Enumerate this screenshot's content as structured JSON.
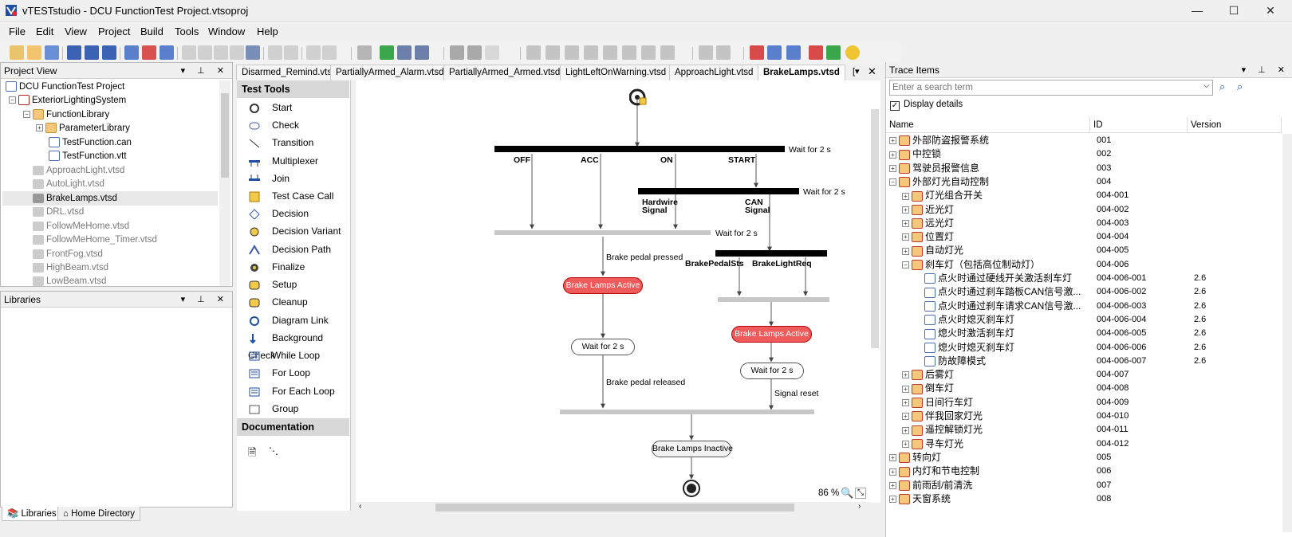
{
  "window": {
    "title": "vTESTstudio - DCU FunctionTest Project.vtsoproj"
  },
  "menu": [
    "File",
    "Edit",
    "View",
    "Project",
    "Build",
    "Tools",
    "Window",
    "Help"
  ],
  "project_view": {
    "title": "Project View",
    "items": [
      {
        "label": "DCU FunctionTest Project"
      },
      {
        "label": "ExteriorLightingSystem"
      },
      {
        "label": "FunctionLibrary"
      },
      {
        "label": "ParameterLibrary"
      },
      {
        "label": "TestFunction.can"
      },
      {
        "label": "TestFunction.vtt"
      },
      {
        "label": "ApproachLight.vtsd"
      },
      {
        "label": "AutoLight.vtsd"
      },
      {
        "label": "BrakeLamps.vtsd"
      },
      {
        "label": "DRL.vtsd"
      },
      {
        "label": "FollowMeHome.vtsd"
      },
      {
        "label": "FollowMeHome_Timer.vtsd"
      },
      {
        "label": "FrontFog.vtsd"
      },
      {
        "label": "HighBeam.vtsd"
      },
      {
        "label": "LowBeam.vtsd"
      }
    ]
  },
  "libraries": {
    "title": "Libraries"
  },
  "bottom_tabs": [
    "Libraries",
    "Home Directory"
  ],
  "editor_tabs": [
    "Disarmed_Remind.vtsd",
    "PartiallyArmed_Alarm.vtsd",
    "PartiallyArmed_Armed.vtsd",
    "LightLeftOnWarning.vtsd",
    "ApproachLight.vtsd",
    "BrakeLamps.vtsd"
  ],
  "test_tools": {
    "section": "Test Tools",
    "items": [
      "Start",
      "Check",
      "Transition",
      "Multiplexer",
      "Join",
      "Test Case Call",
      "Decision",
      "Decision Variant",
      "Decision Path",
      "Finalize",
      "Setup",
      "Cleanup",
      "Diagram Link",
      "Background Check",
      "While Loop",
      "For Loop",
      "For Each Loop",
      "Group"
    ],
    "doc_section": "Documentation"
  },
  "diagram": {
    "wait1": "Wait for 2 s",
    "states": [
      "OFF",
      "ACC",
      "ON",
      "START"
    ],
    "wait2": "Wait for 2 s",
    "hardwire": "Hardwire\nSignal",
    "can": "CAN\nSignal",
    "wait3": "Wait for 2 s",
    "brake_pedal_sts": "BrakePedalSts",
    "brake_light_req": "BrakeLightReq",
    "pressed": "Brake pedal pressed",
    "active1": "Brake Lamps Active",
    "active2": "Brake Lamps Active",
    "wait_node1": "Wait for 2 s",
    "wait_node2": "Wait for 2 s",
    "released": "Brake pedal released",
    "reset": "Signal reset",
    "inactive": "Brake Lamps Inactive",
    "zoom": "86 %"
  },
  "trace_items": {
    "title": "Trace Items",
    "search_placeholder": "Enter a search term",
    "display_details": "Display details",
    "columns": [
      "Name",
      "ID",
      "Version"
    ],
    "rows": [
      {
        "name": "外部防盗报警系统",
        "id": "001",
        "ver": "",
        "level": 0
      },
      {
        "name": "中控锁",
        "id": "002",
        "ver": "",
        "level": 0
      },
      {
        "name": "驾驶员报警信息",
        "id": "003",
        "ver": "",
        "level": 0
      },
      {
        "name": "外部灯光自动控制",
        "id": "004",
        "ver": "",
        "level": 0
      },
      {
        "name": "灯光组合开关",
        "id": "004-001",
        "ver": "",
        "level": 1
      },
      {
        "name": "近光灯",
        "id": "004-002",
        "ver": "",
        "level": 1
      },
      {
        "name": "远光灯",
        "id": "004-003",
        "ver": "",
        "level": 1
      },
      {
        "name": "位置灯",
        "id": "004-004",
        "ver": "",
        "level": 1
      },
      {
        "name": "自动灯光",
        "id": "004-005",
        "ver": "",
        "level": 1
      },
      {
        "name": "刹车灯（包括高位制动灯）",
        "id": "004-006",
        "ver": "",
        "level": 1
      },
      {
        "name": "点火时通过硬线开关激活刹车灯",
        "id": "004-006-001",
        "ver": "2.6",
        "level": 2
      },
      {
        "name": "点火时通过刹车踏板CAN信号激...",
        "id": "004-006-002",
        "ver": "2.6",
        "level": 2
      },
      {
        "name": "点火时通过刹车请求CAN信号激...",
        "id": "004-006-003",
        "ver": "2.6",
        "level": 2
      },
      {
        "name": "点火时熄灭刹车灯",
        "id": "004-006-004",
        "ver": "2.6",
        "level": 2
      },
      {
        "name": "熄火时激活刹车灯",
        "id": "004-006-005",
        "ver": "2.6",
        "level": 2
      },
      {
        "name": "熄火时熄灭刹车灯",
        "id": "004-006-006",
        "ver": "2.6",
        "level": 2
      },
      {
        "name": "防故障模式",
        "id": "004-006-007",
        "ver": "2.6",
        "level": 2
      },
      {
        "name": "后雾灯",
        "id": "004-007",
        "ver": "",
        "level": 1
      },
      {
        "name": "倒车灯",
        "id": "004-008",
        "ver": "",
        "level": 1
      },
      {
        "name": "日间行车灯",
        "id": "004-009",
        "ver": "",
        "level": 1
      },
      {
        "name": "伴我回家灯光",
        "id": "004-010",
        "ver": "",
        "level": 1
      },
      {
        "name": "遥控解锁灯光",
        "id": "004-011",
        "ver": "",
        "level": 1
      },
      {
        "name": "寻车灯光",
        "id": "004-012",
        "ver": "",
        "level": 1
      },
      {
        "name": "转向灯",
        "id": "005",
        "ver": "",
        "level": 0
      },
      {
        "name": "内灯和节电控制",
        "id": "006",
        "ver": "",
        "level": 0
      },
      {
        "name": "前雨刮/前清洗",
        "id": "007",
        "ver": "",
        "level": 0
      },
      {
        "name": "天窗系统",
        "id": "008",
        "ver": "",
        "level": 0
      }
    ]
  },
  "colors": {
    "title_accent": "#f0f0f0",
    "red_node": "#ef5a5a",
    "folder": "#f5c77a"
  }
}
